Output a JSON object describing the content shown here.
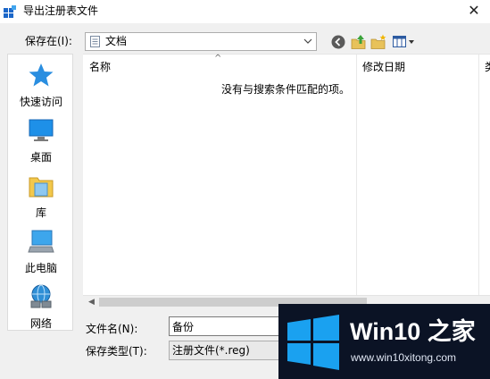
{
  "window": {
    "title": "导出注册表文件",
    "close_glyph": "✕"
  },
  "save_in": {
    "label": "保存在(I):",
    "location": "文档",
    "location_icon": "documents-folder-icon"
  },
  "toolbar": {
    "back_icon": "back-arrow-icon",
    "up_icon": "up-folder-icon",
    "new_folder_icon": "new-folder-icon",
    "view_menu_icon": "view-menu-icon"
  },
  "places": [
    {
      "label": "快速访问",
      "icon": "star-icon"
    },
    {
      "label": "桌面",
      "icon": "desktop-icon"
    },
    {
      "label": "库",
      "icon": "library-icon"
    },
    {
      "label": "此电脑",
      "icon": "computer-icon"
    },
    {
      "label": "网络",
      "icon": "network-icon"
    }
  ],
  "file_list": {
    "columns": [
      "名称",
      "修改日期",
      "类"
    ],
    "empty_message": "没有与搜索条件匹配的项。",
    "sort_glyph": "^"
  },
  "scrollbar": {
    "left_glyph": "◀"
  },
  "file_name": {
    "label": "文件名(N):",
    "value": "备份"
  },
  "file_type": {
    "label": "保存类型(T):",
    "value": "注册文件(*.reg)"
  },
  "watermark": {
    "title": "Win10 之家",
    "url": "www.win10xitong.com"
  },
  "colors": {
    "accent": "#2a74d8",
    "watermark_bg": "#0b1325",
    "windows_logo": "#1aa1f0"
  }
}
